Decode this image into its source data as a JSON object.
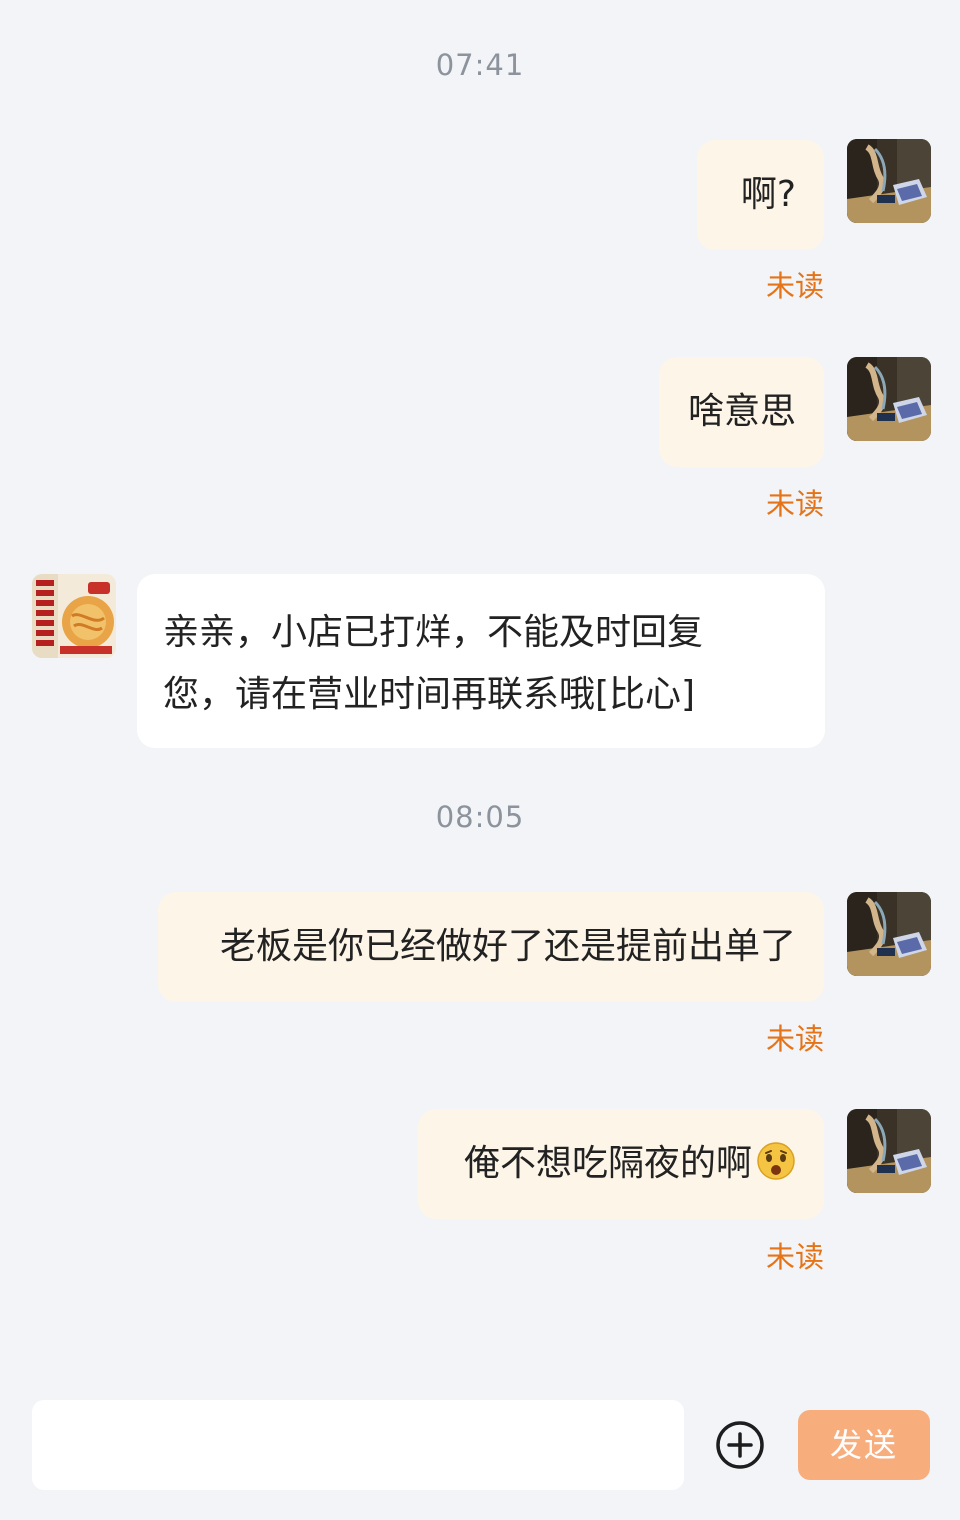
{
  "timestamps": [
    "07:41",
    "08:05"
  ],
  "messages": [
    {
      "sender": "self",
      "text": "啊?",
      "status": "未读"
    },
    {
      "sender": "self",
      "text": "啥意思",
      "status": "未读"
    },
    {
      "sender": "shop",
      "lines": [
        "亲亲，小店已打烊，不能及时回复",
        "您，请在营业时间再联系哦[比心]"
      ]
    },
    {
      "sender": "self",
      "text": "老板是你已经做好了还是提前出单了",
      "status": "未读"
    },
    {
      "sender": "self",
      "text": "俺不想吃隔夜的啊",
      "emoji": "astonished-face",
      "status": "未读"
    }
  ],
  "composer": {
    "input_value": "",
    "plus_icon": "plus-circle-icon",
    "send_label": "发送"
  },
  "colors": {
    "background": "#f2f4f7",
    "self_bubble": "#fdf6e8",
    "other_bubble": "#ffffff",
    "unread": "#e57418",
    "send_button": "#f8ad7d"
  }
}
